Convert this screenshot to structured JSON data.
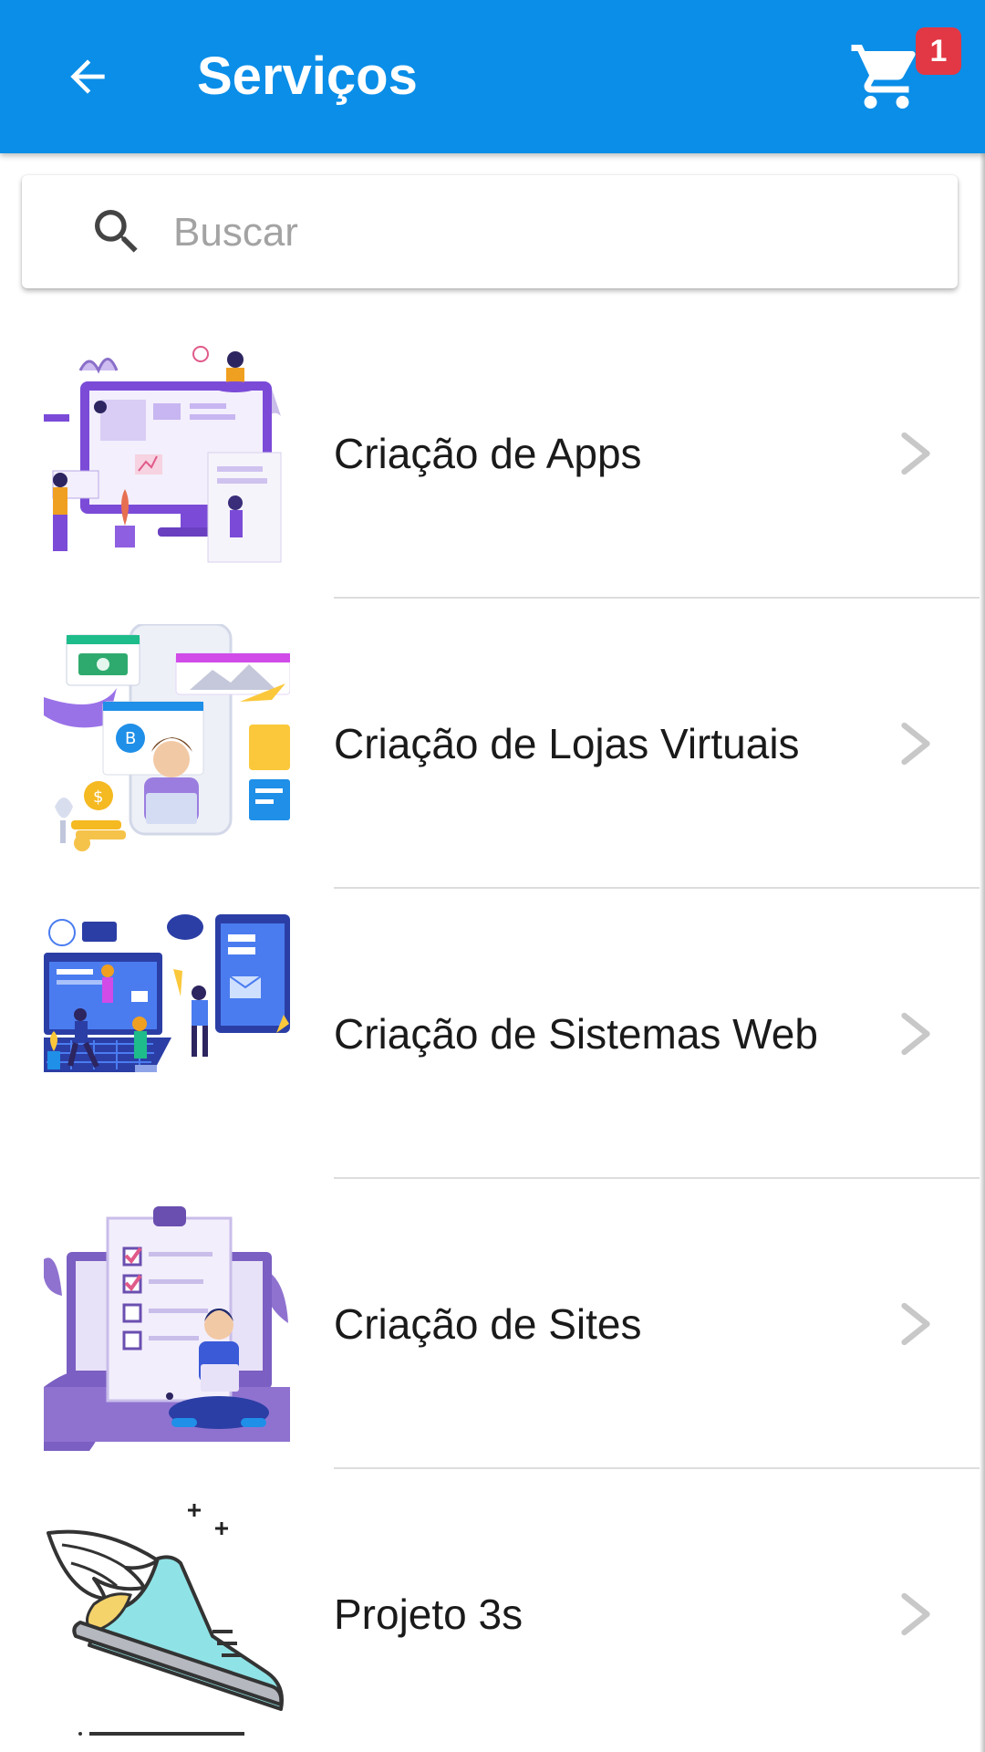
{
  "header": {
    "title": "Serviços",
    "cart_count": "1",
    "back_icon": "arrow-back-icon",
    "cart_icon": "shopping-cart-icon",
    "background_color": "#0a8ee8",
    "badge_color": "#e23744"
  },
  "search": {
    "placeholder": "Buscar",
    "value": "",
    "icon": "search-icon"
  },
  "services": [
    {
      "label": "Criação de Apps",
      "image": "app-design-illustration"
    },
    {
      "label": "Criação de Lojas Virtuais",
      "image": "online-store-illustration"
    },
    {
      "label": "Criação de Sistemas Web",
      "image": "web-systems-illustration"
    },
    {
      "label": "Criação de Sites",
      "image": "website-checklist-illustration"
    },
    {
      "label": "Projeto 3s",
      "image": "winged-shoe-illustration"
    }
  ]
}
